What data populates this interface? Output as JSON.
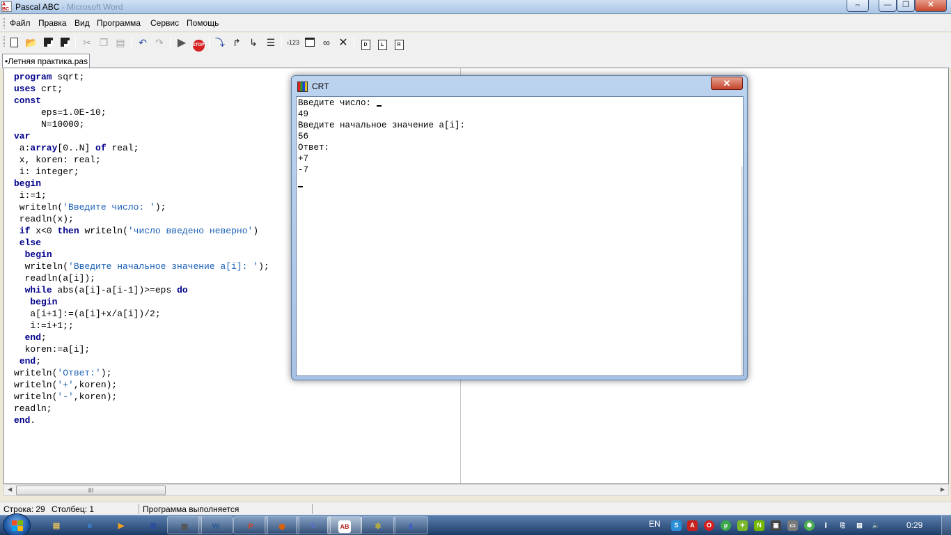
{
  "window": {
    "title": "Pascal ABC",
    "title_ghost": "- Microsoft Word",
    "restore_label": "⇔",
    "minimize_label": "—",
    "maximize_label": "❐",
    "close_label": "✕"
  },
  "menu": {
    "items": [
      "Файл",
      "Правка",
      "Вид",
      "Программа",
      "Сервис",
      "Помощь"
    ]
  },
  "toolbar": {
    "run_to_cursor_label": "›123",
    "stop_label": "STOP",
    "doc1_label": "D",
    "doc2_label": "L",
    "doc3_label": "R"
  },
  "tab": {
    "label": "•Летняя практика.pas"
  },
  "editor": {
    "lines": [
      "program sqrt;",
      "uses crt;",
      "const",
      "     eps=1.0E-10;",
      "     N=10000;",
      "var",
      " a:array[0..N] of real;",
      " x, koren: real;",
      " i: integer;",
      "begin",
      " i:=1;",
      " writeln('Введите число: ');",
      " readln(x);",
      " if x<0 then writeln('число введено неверно')",
      " else",
      "  begin",
      "  writeln('Введите начальное значение a[i]: ');",
      "  readln(a[i]);",
      "  while abs(a[i]-a[i-1])>=eps do",
      "   begin",
      "   a[i+1]:=(a[i]+x/a[i])/2;",
      "   i:=i+1;;",
      "  end;",
      "  koren:=a[i];",
      " end;",
      "writeln('Ответ:');",
      "writeln('+',koren);",
      "writeln('-',koren);",
      "readln;",
      "end."
    ],
    "scroll_thumb_label": "III"
  },
  "status": {
    "line": "Строка: 29",
    "column": "Столбец: 1",
    "message": "Программа выполняется"
  },
  "crt": {
    "title": "CRT",
    "close_label": "✕",
    "output": [
      "Введите число: ",
      "49",
      "Введите начальное значение a[i]:",
      "56",
      "Ответ:",
      "+7",
      "-7"
    ]
  },
  "taskbar": {
    "items": [
      {
        "icon": "explorer-icon",
        "glyph": "▤",
        "color": "#e8c35a"
      },
      {
        "icon": "ie-icon",
        "glyph": "e",
        "color": "#3a8ee6"
      },
      {
        "icon": "media-player-icon",
        "glyph": "▶",
        "color": "#f0a020"
      },
      {
        "icon": "save-app-icon",
        "glyph": "▣",
        "color": "#2c4f9a"
      },
      {
        "icon": "calculator-icon",
        "glyph": "▦",
        "color": "#555555"
      },
      {
        "icon": "word-icon",
        "glyph": "W",
        "color": "#2b5797"
      },
      {
        "icon": "powerpoint-icon",
        "glyph": "P",
        "color": "#d24726"
      },
      {
        "icon": "firefox-icon",
        "glyph": "◉",
        "color": "#e66000"
      },
      {
        "icon": "paint-icon",
        "glyph": "✎",
        "color": "#5a6fc0"
      },
      {
        "icon": "pascal-abc-icon",
        "glyph": "AB",
        "color": "#ffffff"
      },
      {
        "icon": "bug-icon",
        "glyph": "✲",
        "color": "#d8c020"
      },
      {
        "icon": "crt-window-icon",
        "glyph": "▮",
        "color": "#4060c0"
      }
    ],
    "language": "EN",
    "clock": "0:29"
  }
}
